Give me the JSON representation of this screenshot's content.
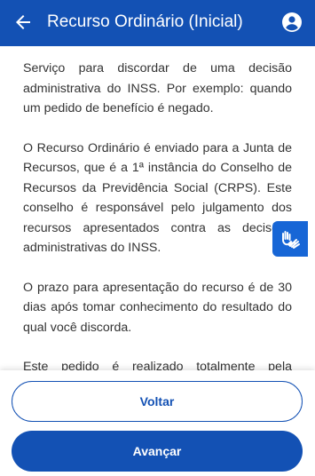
{
  "header": {
    "title": "Recurso Ordinário (Inicial)",
    "back_icon": "arrow-left-icon",
    "user_icon": "user-circle-icon",
    "background_color": "#1351b4"
  },
  "content": {
    "paragraphs": [
      "Serviço para discordar de uma decisão administrativa do INSS. Por exemplo: quando um pedido de benefício é negado.",
      "O Recurso Ordinário é enviado para a Junta de Recursos, que é a 1ª instância do Conselho de Recursos da Previdência Social (CRPS). Este conselho é responsável pelo julgamento dos recursos apresentados contra as decisões administrativas do INSS.",
      "O prazo para apresentação do recurso é de 30 dias após tomar conhecimento do resultado do qual você discorda.",
      "Este pedido é realizado totalmente pela internet."
    ]
  },
  "accessibility_widget": {
    "icon": "sign-language-hands-icon",
    "color": "#1766d6"
  },
  "footer": {
    "back_label": "Voltar",
    "next_label": "Avançar",
    "primary_color": "#1351b4"
  }
}
